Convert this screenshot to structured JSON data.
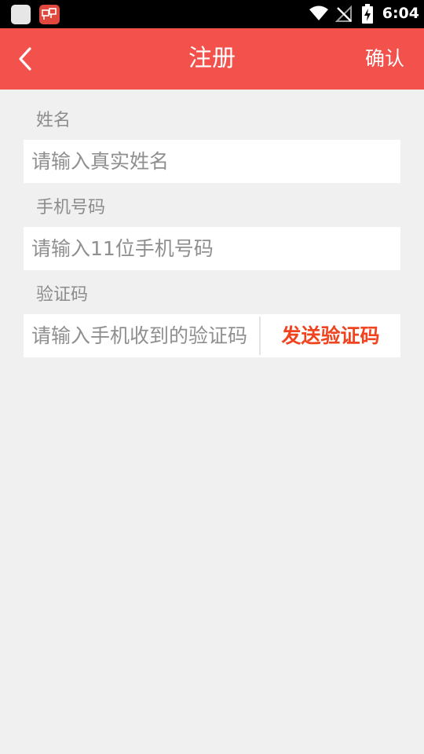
{
  "status_bar": {
    "time": "6:04",
    "icons": [
      "app-icon-blank",
      "app-icon-chat",
      "wifi-icon",
      "no-signal-icon",
      "battery-charging-icon"
    ]
  },
  "app_bar": {
    "title": "注册",
    "back_icon": "chevron-left-icon",
    "confirm_label": "确认"
  },
  "form": {
    "name": {
      "label": "姓名",
      "value": "",
      "placeholder": "请输入真实姓名"
    },
    "phone": {
      "label": "手机号码",
      "value": "",
      "placeholder": "请输入11位手机号码"
    },
    "code": {
      "label": "验证码",
      "value": "",
      "placeholder": "请输入手机收到的验证码",
      "send_label": "发送验证码"
    }
  },
  "colors": {
    "app_bar": "#f2524b",
    "background": "#f0f0f0",
    "send_code_text": "#f0431f",
    "label_text": "#8c8c8c"
  }
}
